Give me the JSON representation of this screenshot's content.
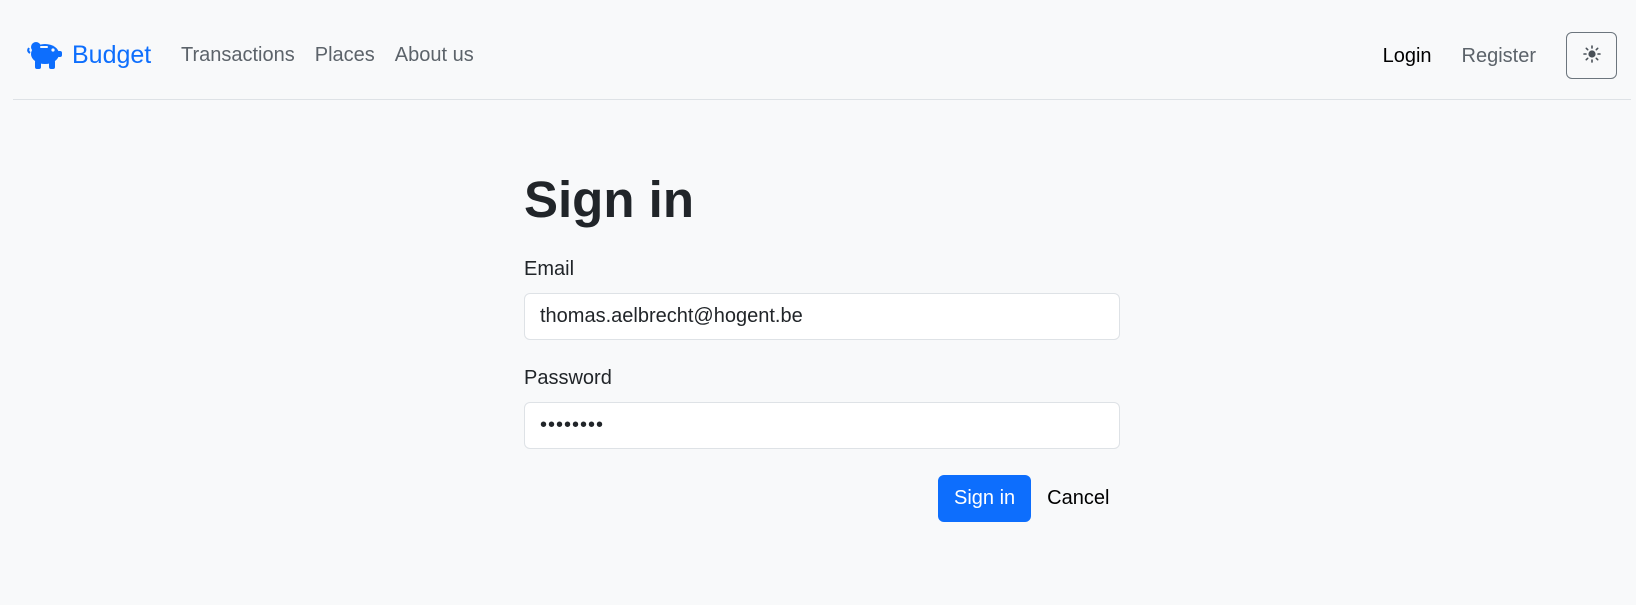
{
  "navbar": {
    "brand_label": "Budget",
    "brand_icon": "piggy-bank-icon",
    "links": [
      {
        "label": "Transactions"
      },
      {
        "label": "Places"
      },
      {
        "label": "About us"
      }
    ],
    "login_label": "Login",
    "register_label": "Register",
    "theme_icon": "sun-icon"
  },
  "form": {
    "title": "Sign in",
    "email_label": "Email",
    "email_value": "thomas.aelbrecht@hogent.be",
    "password_label": "Password",
    "password_value": "••••••••",
    "submit_label": "Sign in",
    "cancel_label": "Cancel"
  },
  "colors": {
    "brand": "#0d6efd",
    "background": "#f8f9fa",
    "primary_button": "#0d6efd"
  }
}
